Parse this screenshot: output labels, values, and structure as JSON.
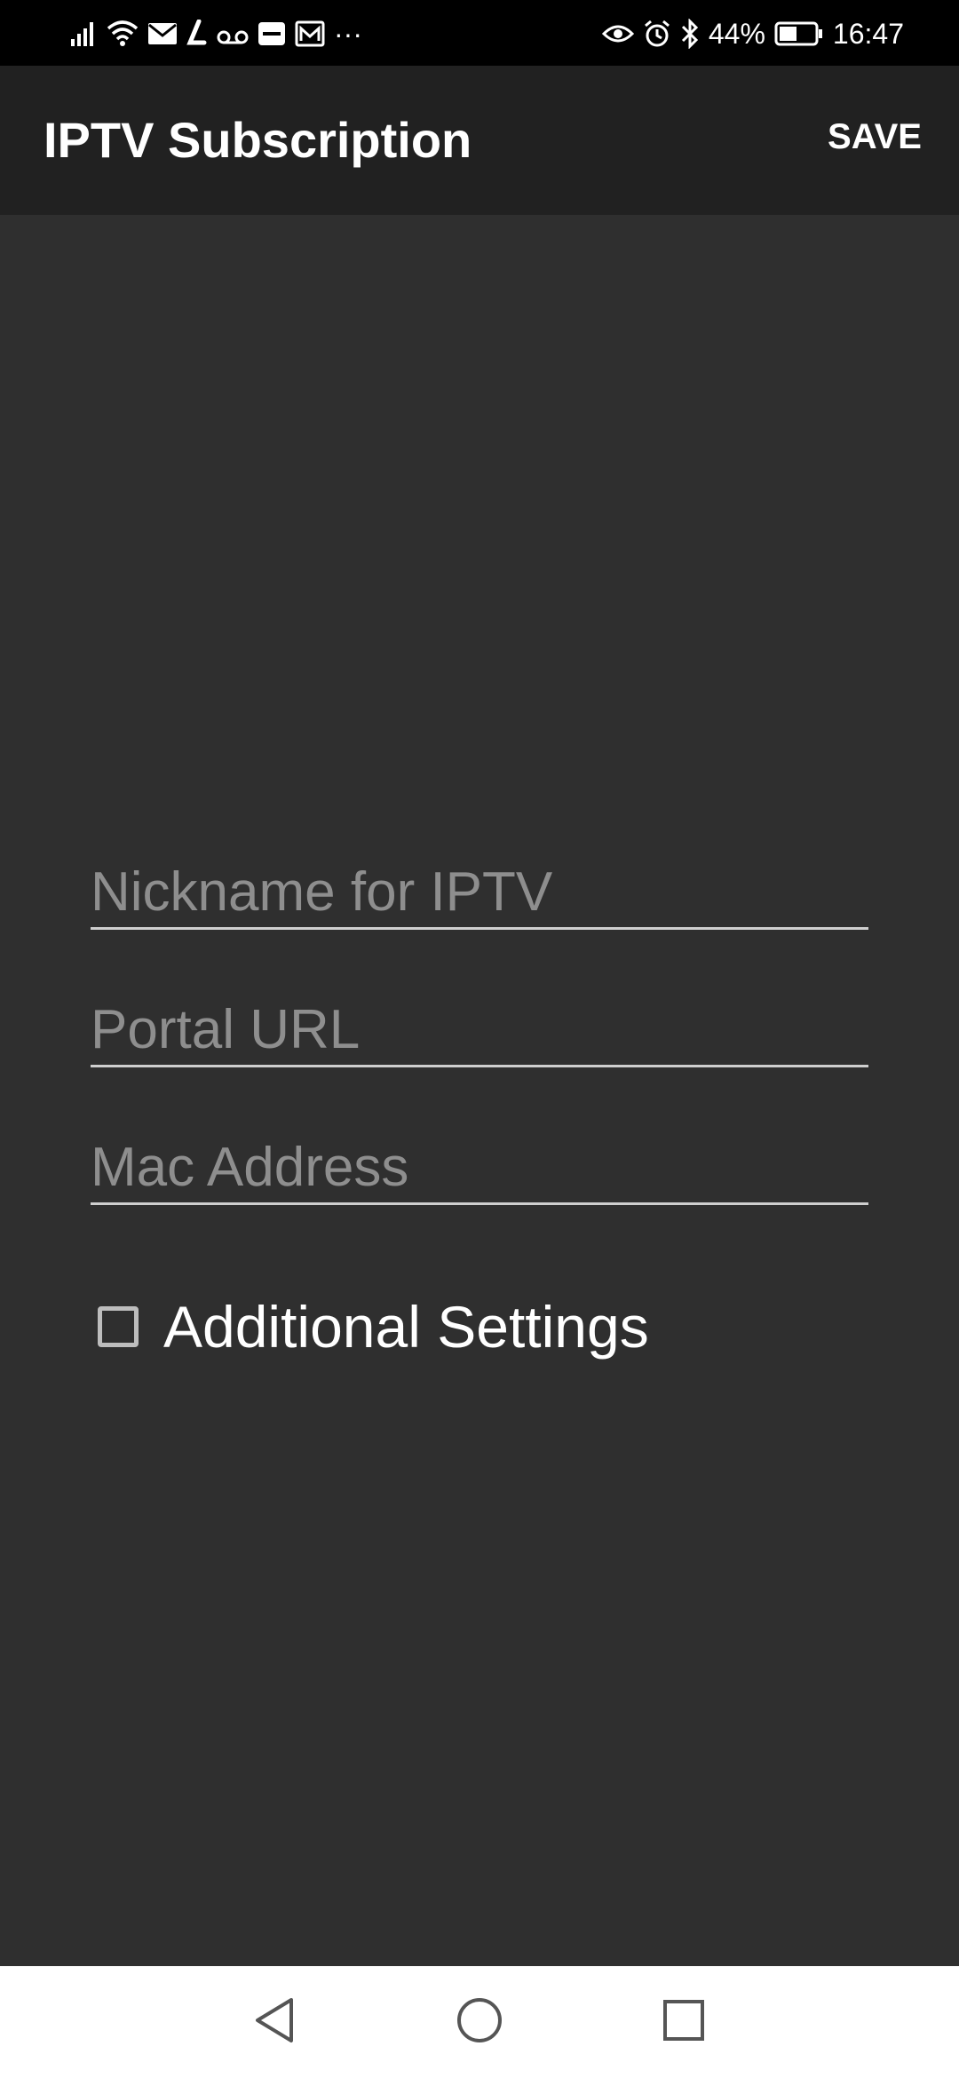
{
  "status_bar": {
    "battery_percent": "44%",
    "time": "16:47",
    "left_icons": [
      "signal-icon",
      "wifi-icon",
      "mail-icon",
      "app-notification-icon",
      "voicemail-icon",
      "sms-icon",
      "gallery-icon",
      "more-icon"
    ],
    "right_icons": [
      "eye-icon",
      "alarm-icon",
      "bluetooth-icon",
      "battery-icon"
    ],
    "more_glyph": "···"
  },
  "app_bar": {
    "title": "IPTV Subscription",
    "save_label": "SAVE"
  },
  "form": {
    "nickname": {
      "value": "",
      "placeholder": "Nickname for IPTV"
    },
    "portal_url": {
      "value": "",
      "placeholder": "Portal URL"
    },
    "mac_address": {
      "value": "",
      "placeholder": "Mac Address"
    },
    "additional_settings": {
      "label": "Additional Settings",
      "checked": false
    }
  },
  "nav_bar": {
    "icons": [
      "back-icon",
      "home-icon",
      "recents-icon"
    ]
  },
  "colors": {
    "background": "#2f2f2f",
    "app_bar": "#212121",
    "status_bar": "#000000",
    "placeholder": "#8e8e8e",
    "underline": "#cfcfcf",
    "text": "#ffffff"
  }
}
